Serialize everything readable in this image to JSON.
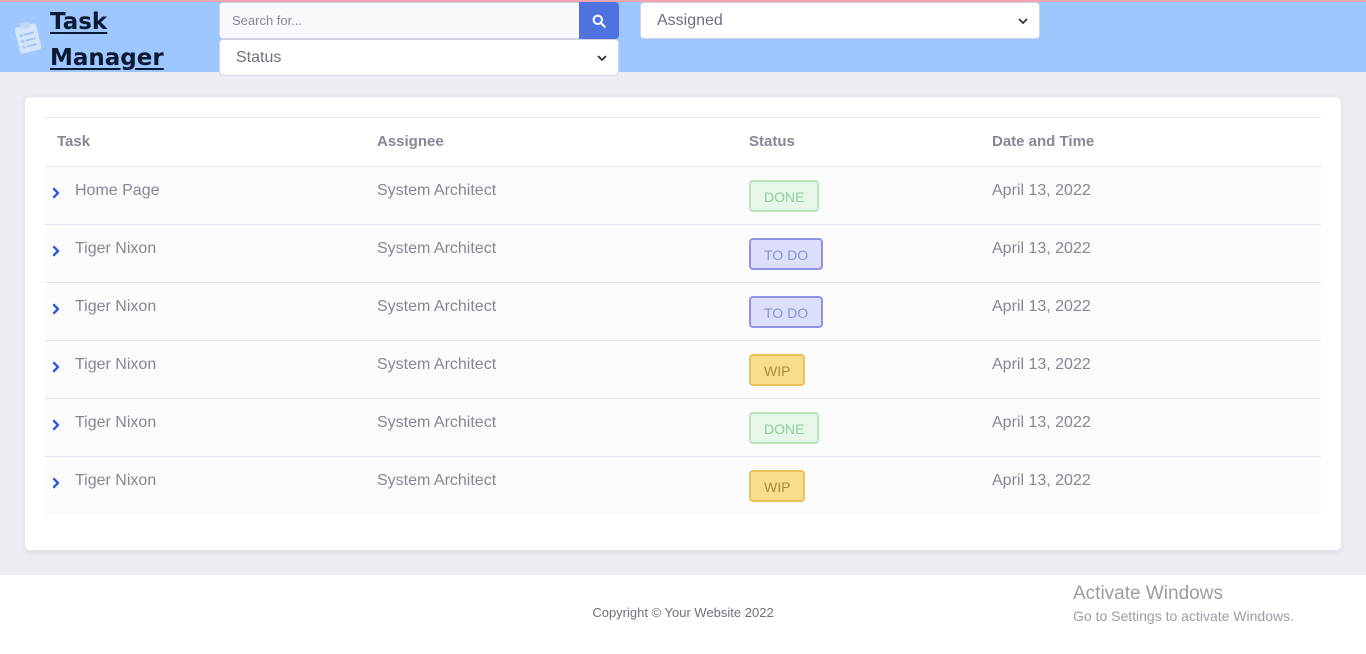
{
  "app": {
    "title": "Task Manager",
    "title_line1": "Task",
    "title_line2": "Manager"
  },
  "search": {
    "placeholder": "Search for..."
  },
  "filters": {
    "status_selected": "Status",
    "assigned_selected": "Assigned"
  },
  "table": {
    "headers": {
      "task": "Task",
      "assignee": "Assignee",
      "status": "Status",
      "date": "Date and Time"
    },
    "rows": [
      {
        "task": "Home Page",
        "assignee": "System Architect",
        "status": "DONE",
        "date": "April 13, 2022"
      },
      {
        "task": "Tiger Nixon",
        "assignee": "System Architect",
        "status": "TO DO",
        "date": "April 13, 2022"
      },
      {
        "task": "Tiger Nixon",
        "assignee": "System Architect",
        "status": "TO DO",
        "date": "April 13, 2022"
      },
      {
        "task": "Tiger Nixon",
        "assignee": "System Architect",
        "status": "WIP",
        "date": "April 13, 2022"
      },
      {
        "task": "Tiger Nixon",
        "assignee": "System Architect",
        "status": "DONE",
        "date": "April 13, 2022"
      },
      {
        "task": "Tiger Nixon",
        "assignee": "System Architect",
        "status": "WIP",
        "date": "April 13, 2022"
      }
    ]
  },
  "footer": {
    "copyright": "Copyright © Your Website 2022"
  },
  "watermark": {
    "title": "Activate Windows",
    "subtitle": "Go to Settings to activate Windows."
  },
  "colors": {
    "topbar": "#9ec6ff",
    "accent": "#4e73df",
    "done": "#e6f6e8",
    "todo": "#dcdefa",
    "wip": "#f7de8c"
  },
  "icons": {
    "brand": "clipboard-icon",
    "search": "search-icon",
    "dropdown": "chevron-down-icon",
    "expander": "chevron-right-icon"
  }
}
